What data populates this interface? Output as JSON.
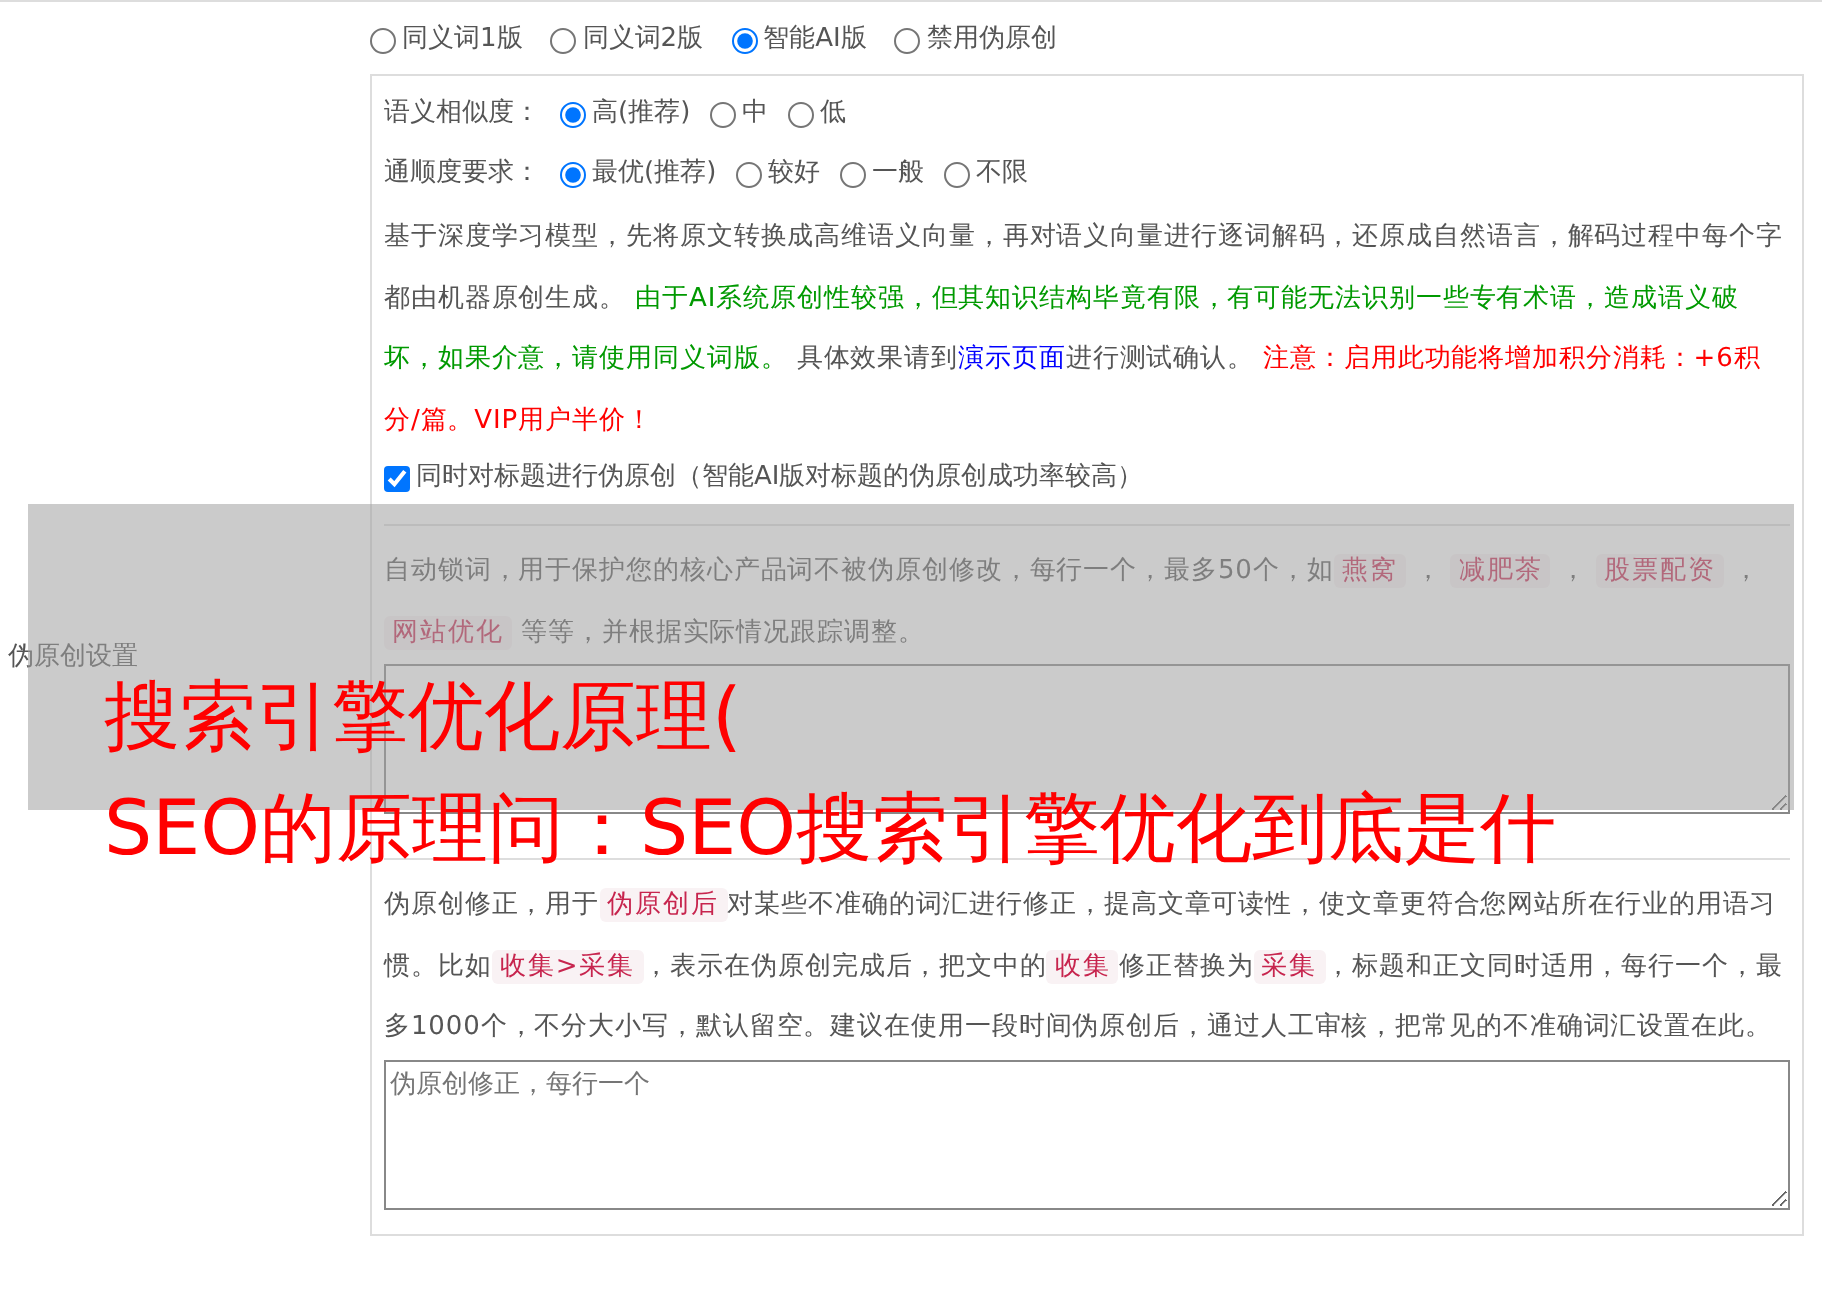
{
  "section_label": "伪原创设置",
  "modes": [
    {
      "label": "同义词1版",
      "selected": false
    },
    {
      "label": "同义词2版",
      "selected": false
    },
    {
      "label": "智能AI版",
      "selected": true
    },
    {
      "label": "禁用伪原创",
      "selected": false
    }
  ],
  "similarity": {
    "label": "语义相似度：",
    "options": [
      {
        "label": "高(推荐)",
        "selected": true
      },
      {
        "label": "中",
        "selected": false
      },
      {
        "label": "低",
        "selected": false
      }
    ]
  },
  "fluency": {
    "label": "通顺度要求：",
    "options": [
      {
        "label": "最优(推荐)",
        "selected": true
      },
      {
        "label": "较好",
        "selected": false
      },
      {
        "label": "一般",
        "selected": false
      },
      {
        "label": "不限",
        "selected": false
      }
    ]
  },
  "ai_description": [
    {
      "kind": "plain",
      "text": "基于深度学习模型，先将原文转换成高维语义向量，再对语义向量进行逐词解码，还原成自然语言，解码过程中每个字都由机器原创生成。 "
    },
    {
      "kind": "green",
      "text": "由于AI系统原创性较强，但其知识结构毕竟有限，有可能无法识别一些专有术语，造成语义破坏，如果介意，请使用同义词版。"
    },
    {
      "kind": "plain",
      "text": " 具体效果请到"
    },
    {
      "kind": "link",
      "text": "演示页面"
    },
    {
      "kind": "plain",
      "text": "进行测试确认。 "
    },
    {
      "kind": "red",
      "text": "注意：启用此功能将增加积分消耗：+6积分/篇。VIP用户半价！"
    }
  ],
  "title_option": {
    "label": "同时对标题进行伪原创（智能AI版对标题的伪原创成功率较高）",
    "checked": true
  },
  "lock_words": {
    "description": [
      {
        "kind": "plain",
        "text": "自动锁词，用于保护您的核心产品词不被伪原创修改，每行一个，最多50个，如"
      },
      {
        "kind": "code",
        "text": "燕窝"
      },
      {
        "kind": "plain",
        "text": " ， "
      },
      {
        "kind": "code",
        "text": "减肥茶"
      },
      {
        "kind": "plain",
        "text": " ， "
      },
      {
        "kind": "code",
        "text": "股票配资"
      },
      {
        "kind": "plain",
        "text": " ， "
      },
      {
        "kind": "code",
        "text": "网站优化"
      },
      {
        "kind": "plain",
        "text": " 等等，并根据实际情况跟踪调整。"
      }
    ]
  },
  "corrections": {
    "description": [
      {
        "kind": "plain",
        "text": "伪原创修正，用于"
      },
      {
        "kind": "code",
        "text": "伪原创后"
      },
      {
        "kind": "plain",
        "text": "对某些不准确的词汇进行修正，提高文章可读性，使文章更符合您网站所在行业的用语习惯。比如"
      },
      {
        "kind": "code",
        "text": "收集>采集"
      },
      {
        "kind": "plain",
        "text": "，表示在伪原创完成后，把文中的"
      },
      {
        "kind": "code",
        "text": "收集"
      },
      {
        "kind": "plain",
        "text": "修正替换为"
      },
      {
        "kind": "code",
        "text": "采集"
      },
      {
        "kind": "plain",
        "text": "，标题和正文同时适用，每行一个，最多1000个，不分大小写，默认留空。建议在使用一段时间伪原创后，通过人工审核，把常见的不准确词汇设置在此。"
      }
    ],
    "placeholder": "伪原创修正，每行一个"
  },
  "overlay_banner": [
    "搜索引擎优化原理(",
    "SEO的原理问：SEO搜索引擎优化到底是什"
  ]
}
